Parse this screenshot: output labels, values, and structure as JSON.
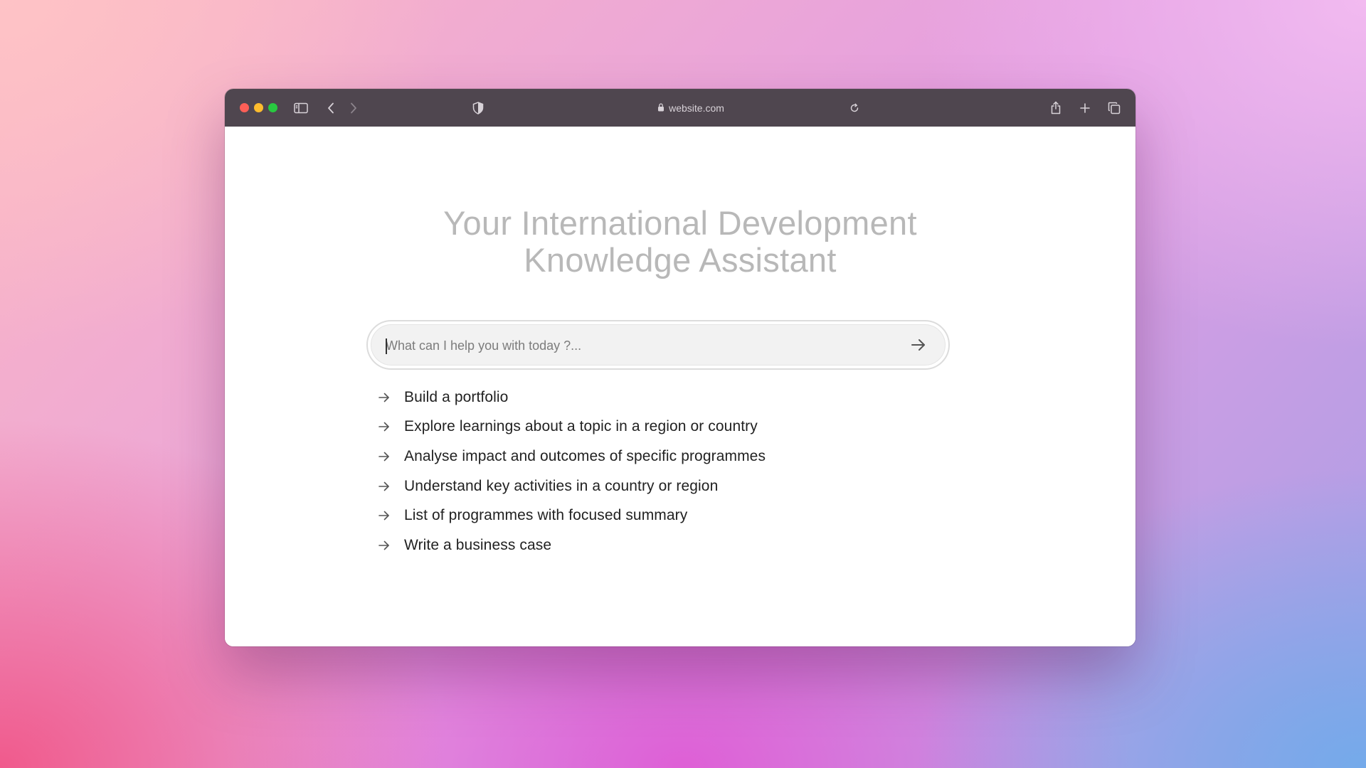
{
  "browser": {
    "url": "website.com",
    "icons": {
      "close": "red-dot",
      "minimize": "yellow-dot",
      "maximize": "green-dot",
      "sidebar": "sidebar-icon",
      "back": "chevron-left-icon",
      "forward": "chevron-right-icon",
      "privacy": "shield-icon",
      "lock": "lock-icon",
      "reload": "reload-icon",
      "share": "share-icon",
      "new_tab": "plus-icon",
      "tabs": "tabs-overview-icon"
    },
    "colors": {
      "toolbar": "#4f464f",
      "close": "#fe5f57",
      "minimize": "#febc2e",
      "maximize": "#28c840"
    }
  },
  "page": {
    "title_line1": "Your International Development",
    "title_line2": "Knowledge Assistant",
    "search": {
      "value": "",
      "placeholder": "What can I help you with today ?...",
      "submit_icon": "arrow-right-icon"
    },
    "suggestions": [
      {
        "label": "Build a portfolio"
      },
      {
        "label": "Explore learnings about a topic in a region or country"
      },
      {
        "label": "Analyse impact and outcomes of specific programmes"
      },
      {
        "label": "Understand key activities in a country or region"
      },
      {
        "label": "List of programmes with focused summary"
      },
      {
        "label": "Write a business case"
      }
    ]
  }
}
